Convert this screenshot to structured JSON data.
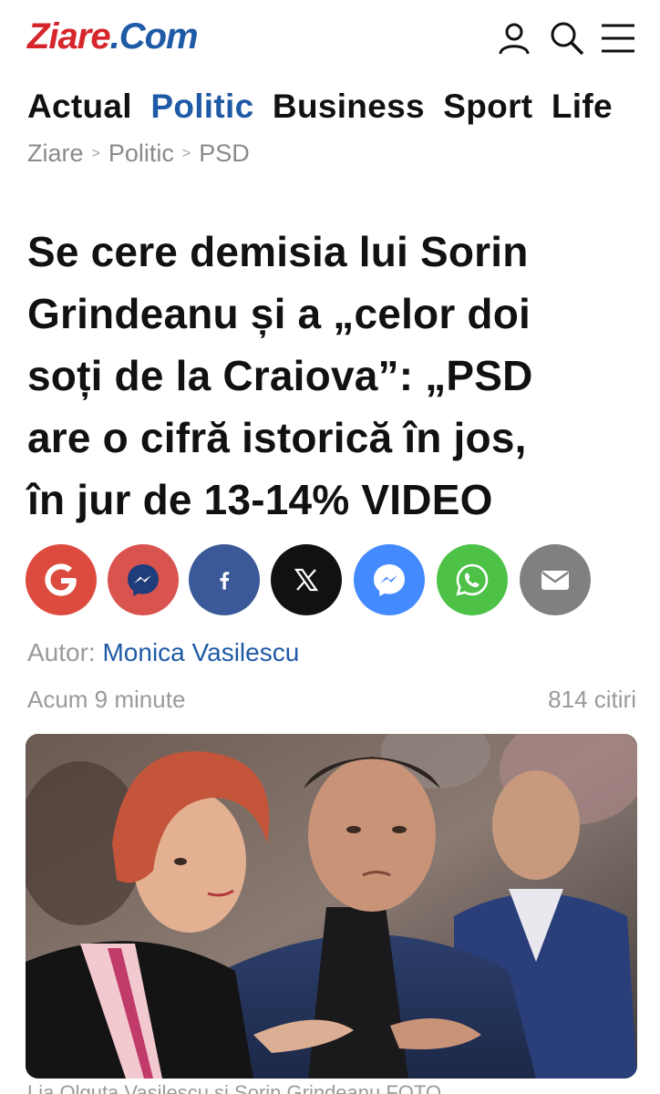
{
  "header": {
    "logo_main": "Ziare",
    "logo_dot": ".",
    "logo_c": "C",
    "logo_om": "om",
    "icons": [
      "user-icon",
      "search-icon",
      "menu-icon"
    ]
  },
  "nav": {
    "items": [
      "Actual",
      "Politic",
      "Business",
      "Sport",
      "Life"
    ],
    "active": "Politic"
  },
  "breadcrumb": {
    "items": [
      "Ziare",
      "Politic",
      "PSD"
    ],
    "separator": ">"
  },
  "article": {
    "title_lines": [
      "Se cere demisia lui Sorin",
      "Grindeanu și a „celor doi",
      "soți de la Craiova”: „PSD",
      "are o cifră istorică în jos,",
      "în jur de 13-14% VIDEO"
    ],
    "author_label": "Autor:",
    "author_name": "Monica Vasilescu",
    "time": "Acum 9 minute",
    "reads": "814 citiri",
    "caption": "Lia Olguța Vasilescu și Sorin Grindeanu   FOTO"
  },
  "share": {
    "buttons": [
      {
        "name": "google",
        "color": "#dd4b3e"
      },
      {
        "name": "messenger-red",
        "color": "#d9534f"
      },
      {
        "name": "facebook",
        "color": "#3b5998"
      },
      {
        "name": "x",
        "color": "#111111"
      },
      {
        "name": "messenger",
        "color": "#448aff"
      },
      {
        "name": "whatsapp",
        "color": "#4dc247"
      },
      {
        "name": "email",
        "color": "#808080"
      }
    ]
  },
  "colors": {
    "brand_red": "#d7262b",
    "brand_blue": "#1f5aa6",
    "muted": "#9a9a9a"
  }
}
